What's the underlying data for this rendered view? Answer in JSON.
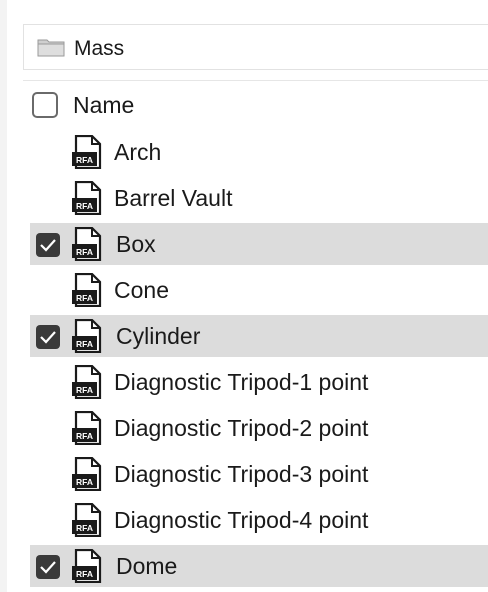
{
  "path": {
    "label": "Mass"
  },
  "header": {
    "name_label": "Name",
    "checked": false
  },
  "icons": {
    "folder": "folder-icon",
    "file": "rfa-file-icon",
    "file_badge": "RFA",
    "check": "checkmark-icon"
  },
  "colors": {
    "selected_row": "#dcdcdc",
    "checkbox_fill": "#3a3a3a"
  },
  "items": [
    {
      "label": "Arch",
      "checked": false
    },
    {
      "label": "Barrel Vault",
      "checked": false
    },
    {
      "label": "Box",
      "checked": true
    },
    {
      "label": "Cone",
      "checked": false
    },
    {
      "label": "Cylinder",
      "checked": true
    },
    {
      "label": "Diagnostic Tripod-1 point",
      "checked": false
    },
    {
      "label": "Diagnostic Tripod-2 point",
      "checked": false
    },
    {
      "label": "Diagnostic Tripod-3 point",
      "checked": false
    },
    {
      "label": "Diagnostic Tripod-4 point",
      "checked": false
    },
    {
      "label": "Dome",
      "checked": true
    }
  ]
}
